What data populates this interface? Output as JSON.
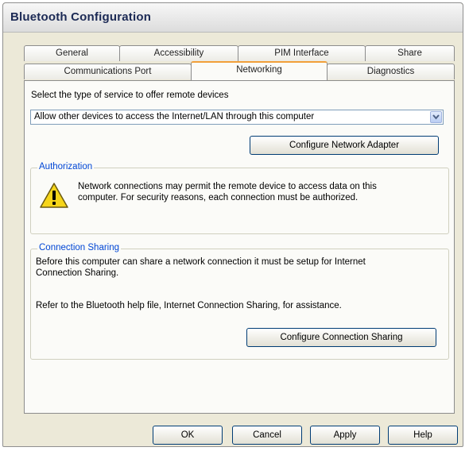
{
  "window": {
    "title": "Bluetooth Configuration"
  },
  "tabs": {
    "row1": [
      "General",
      "Accessibility",
      "PIM Interface",
      "Share"
    ],
    "row2": [
      "Communications Port",
      "Networking",
      "Diagnostics"
    ],
    "active": "Networking"
  },
  "networking": {
    "service_label": "Select the type of service to offer remote devices",
    "service_selected": "Allow other devices to access the Internet/LAN through this computer",
    "configure_adapter_button": "Configure Network Adapter",
    "authorization": {
      "title": "Authorization",
      "text_line1": "Network connections may permit the remote device to access data on this",
      "text_line2": "computer.  For security reasons, each connection must be authorized."
    },
    "connection_sharing": {
      "title": "Connection Sharing",
      "text_line1": "Before this computer can share a network connection it must be setup for Internet",
      "text_line2": "Connection Sharing.",
      "help_text": "Refer to the Bluetooth help file, Internet Connection Sharing, for assistance.",
      "button": "Configure Connection Sharing"
    }
  },
  "footer": {
    "ok": "OK",
    "cancel": "Cancel",
    "apply": "Apply",
    "help": "Help"
  },
  "icons": {
    "warning": "warning-icon",
    "dropdown": "chevron-down-icon"
  },
  "colors": {
    "group_title": "#0046d5",
    "active_tab_accent": "#f2a03a",
    "button_border": "#003c74"
  }
}
